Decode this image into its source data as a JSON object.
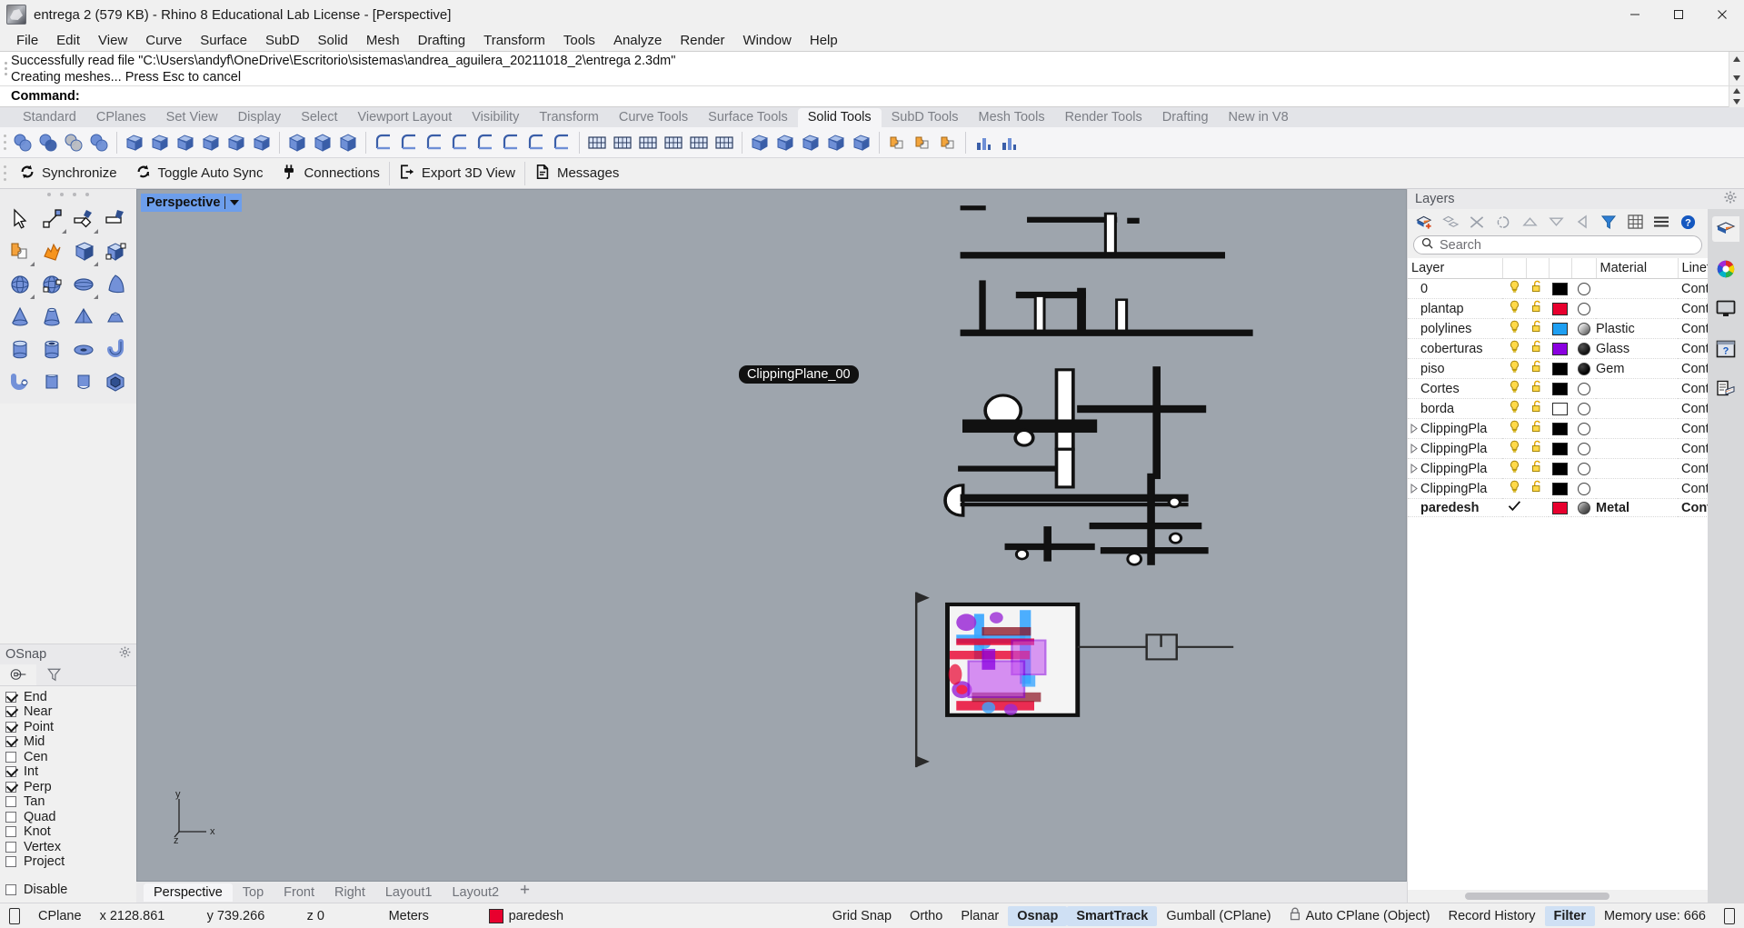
{
  "window": {
    "title": "entrega 2 (579 KB) - Rhino 8 Educational Lab License - [Perspective]",
    "minimize": "–",
    "maximize": "❐",
    "close": "✕",
    "app_icon": "rhino-logo-icon"
  },
  "menubar": {
    "items": [
      "File",
      "Edit",
      "View",
      "Curve",
      "Surface",
      "SubD",
      "Solid",
      "Mesh",
      "Drafting",
      "Transform",
      "Tools",
      "Analyze",
      "Render",
      "Window",
      "Help"
    ]
  },
  "command": {
    "history": [
      "Successfully read file \"C:\\Users\\andyf\\OneDrive\\Escritorio\\sistemas\\andrea_aguilera_20211018_2\\entrega 2.3dm\"",
      "Creating meshes... Press Esc to cancel"
    ],
    "prompt_label": "Command:",
    "input_value": "",
    "scroll_up": "▲",
    "scroll_down": "▼"
  },
  "toolbar_tabs": {
    "items": [
      "Standard",
      "CPlanes",
      "Set View",
      "Display",
      "Select",
      "Viewport Layout",
      "Visibility",
      "Transform",
      "Curve Tools",
      "Surface Tools",
      "Solid Tools",
      "SubD Tools",
      "Mesh Tools",
      "Render Tools",
      "Drafting",
      "New in V8"
    ],
    "active": "Solid Tools"
  },
  "solid_toolbar": {
    "groups": [
      [
        "boolean-union-icon",
        "boolean-difference-icon",
        "boolean-intersection-icon",
        "boolean-split-icon"
      ],
      [
        "extrude-planar-curve-icon",
        "extrude-along-curve-icon",
        "extrude-surface-icon",
        "slab-icon",
        "box-edit-icon",
        "solid-union-icon"
      ],
      [
        "cap-planar-holes-icon",
        "cap-icon",
        "extract-surface-icon"
      ],
      [
        "merge-faces-icon",
        "solid-offset-icon",
        "shell-icon",
        "wirecut-icon",
        "solid-fillet-icon",
        "variable-fillet-icon",
        "chamfer-edge-icon",
        "fillet-edge-icon"
      ],
      [
        "hole-round-icon",
        "hole-rect-icon",
        "make-hole-icon",
        "move-hole-icon",
        "rotate-hole-icon",
        "array-hole-icon"
      ],
      [
        "text-solid-icon",
        "picture-frame-icon",
        "pipe-icon",
        "pipe-nonplanar-icon",
        "unroll-icon"
      ],
      [
        "mesh-from-solid-icon",
        "mesh-grid-icon",
        "mesh-dense-icon"
      ],
      [
        "cage-edit-icon",
        "tween-curves-icon"
      ]
    ]
  },
  "rhino_inside_bar": {
    "buttons": [
      {
        "label": "Synchronize",
        "icon": "sync-icon"
      },
      {
        "label": "Toggle Auto Sync",
        "icon": "auto-sync-icon"
      },
      {
        "label": "Connections",
        "icon": "plug-icon"
      },
      {
        "label": "Export 3D View",
        "icon": "export-icon"
      },
      {
        "label": "Messages",
        "icon": "document-icon"
      }
    ]
  },
  "left_toolpalette": {
    "rows": [
      [
        "select-arrow-icon",
        "point-objects-icon",
        "polyline-icon",
        "line-segment-icon"
      ],
      [
        "puzzle-boolean-icon",
        "explode-icon",
        "box-icon",
        "box-corner-to-corner-icon"
      ],
      [
        "sphere-icon",
        "sphere-3pt-icon",
        "ellipsoid-icon",
        "paraboloid-icon"
      ],
      [
        "cone-icon",
        "truncated-cone-icon",
        "pyramid-icon",
        "truncated-pyramid-icon"
      ],
      [
        "cylinder-icon",
        "tube-icon",
        "torus-icon",
        "pipe-icon"
      ],
      [
        "pipe-cap-icon",
        "extrude-surface-icon",
        "extrude-tapered-icon",
        "polyhedron-icon"
      ]
    ]
  },
  "osnap": {
    "title": "OSnap",
    "gear_icon": "gear-icon",
    "tabs": [
      "osnap-target-icon",
      "osnap-filter-icon"
    ],
    "active_tab": 0,
    "items": [
      {
        "label": "End",
        "checked": true
      },
      {
        "label": "Near",
        "checked": true
      },
      {
        "label": "Point",
        "checked": true
      },
      {
        "label": "Mid",
        "checked": true
      },
      {
        "label": "Cen",
        "checked": false
      },
      {
        "label": "Int",
        "checked": true
      },
      {
        "label": "Perp",
        "checked": true
      },
      {
        "label": "Tan",
        "checked": false
      },
      {
        "label": "Quad",
        "checked": false
      },
      {
        "label": "Knot",
        "checked": false
      },
      {
        "label": "Vertex",
        "checked": false
      },
      {
        "label": "Project",
        "checked": false
      }
    ],
    "disable": {
      "label": "Disable",
      "checked": false
    }
  },
  "viewport": {
    "label": "Perspective",
    "dropdown_icon": "chevron-down-icon",
    "background": "#9ea5ad",
    "clipping_plane_label": "ClippingPlane_00",
    "axis": {
      "x": "x",
      "y": "y",
      "z": "z"
    }
  },
  "viewport_tabs": {
    "items": [
      "Perspective",
      "Top",
      "Front",
      "Right",
      "Layout1",
      "Layout2"
    ],
    "active": "Perspective",
    "add_icon": "plus-icon"
  },
  "layers_panel": {
    "title": "Layers",
    "gear_icon": "gear-icon",
    "tools": [
      "new-layer-icon",
      "new-sublayer-icon",
      "delete-layer-icon",
      "select-objects-icon",
      "move-up-icon",
      "move-down-icon",
      "previous-icon",
      "filter-icon",
      "grid-icon",
      "menu-icon",
      "help-icon"
    ],
    "search": {
      "placeholder": "Search",
      "value": "",
      "icon": "search-icon"
    },
    "columns": [
      "Layer",
      "",
      "",
      "",
      "",
      "Material",
      "Linet"
    ],
    "rows": [
      {
        "name": "0",
        "current": false,
        "expand": false,
        "light": true,
        "lock": true,
        "color": "#000000",
        "material": "",
        "material_type": "none",
        "linetype": "Conti"
      },
      {
        "name": "plantap",
        "current": false,
        "expand": false,
        "light": true,
        "lock": true,
        "color": "#e8002e",
        "material": "",
        "material_type": "none",
        "linetype": "Conti"
      },
      {
        "name": "polylines",
        "current": false,
        "expand": false,
        "light": true,
        "lock": true,
        "color": "#1e9ff2",
        "material": "Plastic",
        "material_type": "plastic",
        "linetype": "Conti"
      },
      {
        "name": "coberturas",
        "current": false,
        "expand": false,
        "light": true,
        "lock": true,
        "color": "#8a00e0",
        "material": "Glass",
        "material_type": "glass",
        "linetype": "Conti"
      },
      {
        "name": "piso",
        "current": false,
        "expand": false,
        "light": true,
        "lock": true,
        "color": "#000000",
        "material": "Gem",
        "material_type": "gem",
        "linetype": "Conti"
      },
      {
        "name": "Cortes",
        "current": false,
        "expand": false,
        "light": true,
        "lock": true,
        "color": "#000000",
        "material": "",
        "material_type": "none",
        "linetype": "Conti"
      },
      {
        "name": "borda",
        "current": false,
        "expand": false,
        "light": true,
        "lock": true,
        "color": "#ffffff",
        "material": "",
        "material_type": "none",
        "linetype": "Conti"
      },
      {
        "name": "ClippingPla",
        "current": false,
        "expand": true,
        "light": true,
        "lock": true,
        "color": "#000000",
        "material": "",
        "material_type": "none",
        "linetype": "Conti"
      },
      {
        "name": "ClippingPla",
        "current": false,
        "expand": true,
        "light": true,
        "lock": true,
        "color": "#000000",
        "material": "",
        "material_type": "none",
        "linetype": "Conti"
      },
      {
        "name": "ClippingPla",
        "current": false,
        "expand": true,
        "light": true,
        "lock": true,
        "color": "#000000",
        "material": "",
        "material_type": "none",
        "linetype": "Conti"
      },
      {
        "name": "ClippingPla",
        "current": false,
        "expand": true,
        "light": true,
        "lock": true,
        "color": "#000000",
        "material": "",
        "material_type": "none",
        "linetype": "Conti"
      },
      {
        "name": "paredesh",
        "current": true,
        "expand": false,
        "light": false,
        "lock": false,
        "color": "#e8002e",
        "material": "Metal",
        "material_type": "metal",
        "linetype": "Conti"
      }
    ],
    "side_tabs": [
      "layers-tab-icon",
      "color-wheel-icon",
      "display-tab-icon",
      "help-tab-icon",
      "properties-tab-icon"
    ]
  },
  "statusbar": {
    "lock_icon": "padlock-icon",
    "cplane": "CPlane",
    "x": "x 2128.861",
    "y": "y 739.266",
    "z": "z 0",
    "units": "Meters",
    "layer_color": "#e8002e",
    "layer": "paredesh",
    "toggles": [
      {
        "label": "Grid Snap",
        "active": false
      },
      {
        "label": "Ortho",
        "active": false
      },
      {
        "label": "Planar",
        "active": false
      },
      {
        "label": "Osnap",
        "active": true
      },
      {
        "label": "SmartTrack",
        "active": true
      },
      {
        "label": "Gumball (CPlane)",
        "active": false
      },
      {
        "label": "Auto CPlane (Object)",
        "active": false,
        "icon": "padlock-icon"
      },
      {
        "label": "Record History",
        "active": false
      },
      {
        "label": "Filter",
        "active": true
      }
    ],
    "memory": "Memory use: 666"
  }
}
